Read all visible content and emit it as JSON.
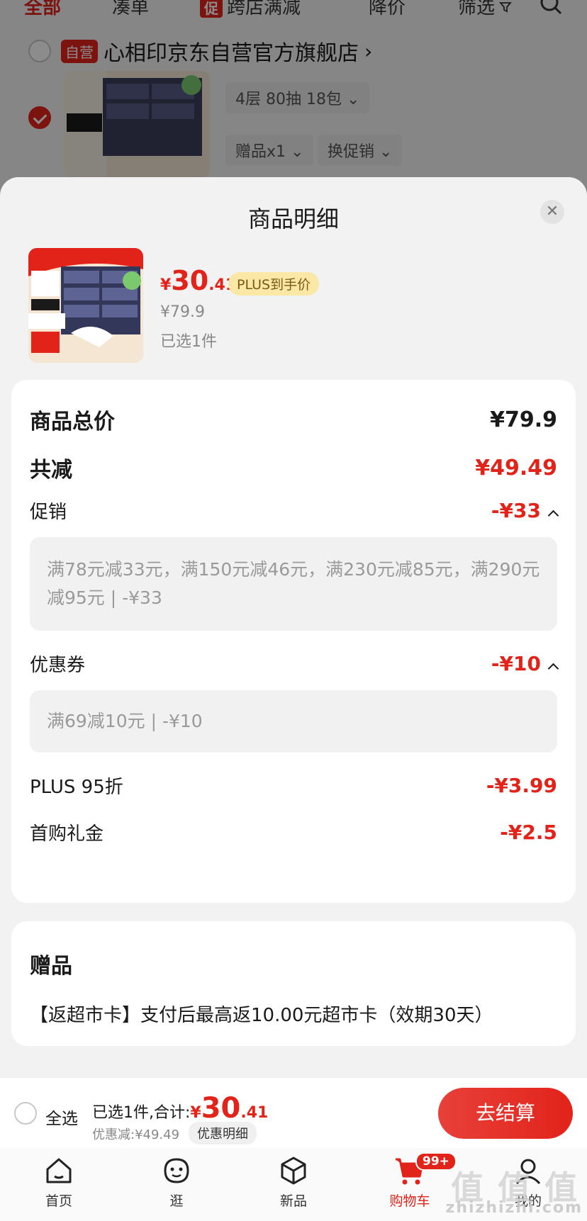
{
  "background_page": {
    "tabs": [
      {
        "label": "全部"
      },
      {
        "label": "凑单"
      },
      {
        "badge": "促",
        "label": "跨店满减"
      },
      {
        "label": "降价"
      },
      {
        "label": "筛选"
      }
    ],
    "store": {
      "badge": "自营",
      "name": "心相印京东自营官方旗舰店"
    },
    "product": {
      "spec": "4层 80抽 18包",
      "gift": "赠品x1",
      "promo": "换促销"
    }
  },
  "sheet": {
    "title": "商品明细",
    "product": {
      "price_symbol": "¥",
      "price_int": "30",
      "price_dec": ".41",
      "plus_tag": "PLUS到手价",
      "original_price": "¥79.9",
      "selected_count": "已选1件"
    },
    "breakdown": {
      "total_label": "商品总价",
      "total_value": "¥79.9",
      "reduce_label": "共减",
      "reduce_value": "¥49.49",
      "promo_label": "促销",
      "promo_value": "-¥33",
      "promo_detail": "满78元减33元，满150元减46元，满230元减85元，满290元减95元 | -¥33",
      "coupon_label": "优惠券",
      "coupon_value": "-¥10",
      "coupon_detail": "满69减10元 | -¥10",
      "plus_label": "PLUS 95折",
      "plus_value": "-¥3.99",
      "first_label": "首购礼金",
      "first_value": "-¥2.5"
    },
    "gift": {
      "title": "赠品",
      "text": "【返超市卡】支付后最高返10.00元超市卡（效期30天）"
    }
  },
  "checkout": {
    "select_all": "全选",
    "selected_sum_label": "已选1件,合计:",
    "price_symbol": "¥",
    "price_int": "30",
    "price_dec": ".41",
    "discount_text": "优惠减:¥49.49",
    "detail_link": "优惠明细",
    "pay_button": "去结算"
  },
  "tabbar": {
    "items": [
      {
        "label": "首页",
        "icon": "home-icon"
      },
      {
        "label": "逛",
        "icon": "face-icon"
      },
      {
        "label": "新品",
        "icon": "cube-icon"
      },
      {
        "label": "购物车",
        "icon": "cart-icon",
        "badge": "99+"
      },
      {
        "label": "我的",
        "icon": "profile-icon"
      }
    ]
  },
  "watermark": {
    "text": "值 值 值",
    "sub": "zhizhizhi.com"
  },
  "colors": {
    "accent": "#e2231a",
    "plus_tag_bg": "#fbe8a6",
    "sheet_bg": "#f2f2f2"
  }
}
